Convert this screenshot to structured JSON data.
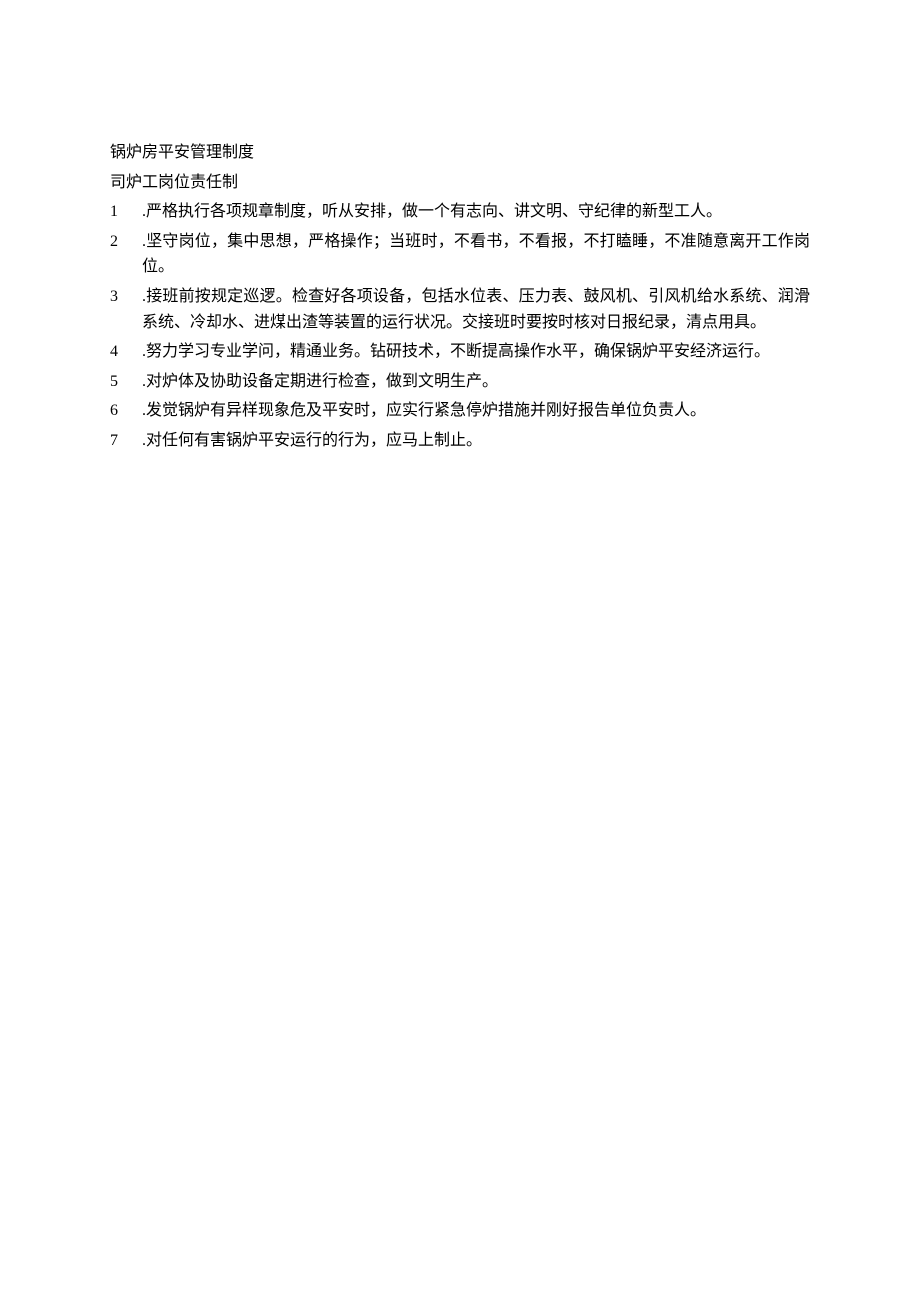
{
  "title": "锅炉房平安管理制度",
  "subtitle": "司炉工岗位责任制",
  "items": [
    {
      "number": "1",
      "text": ".严格执行各项规章制度，听从安排，做一个有志向、讲文明、守纪律的新型工人。"
    },
    {
      "number": "2",
      "text": ".坚守岗位，集中思想，严格操作；当班时，不看书，不看报，不打瞌睡，不准随意离开工作岗位。"
    },
    {
      "number": "3",
      "text": ".接班前按规定巡逻。检查好各项设备，包括水位表、压力表、鼓风机、引风机给水系统、润滑系统、冷却水、进煤出渣等装置的运行状况。交接班时要按时核对日报纪录，清点用具。"
    },
    {
      "number": "4",
      "text": ".努力学习专业学问，精通业务。钻研技术，不断提高操作水平，确保锅炉平安经济运行。"
    },
    {
      "number": "5",
      "text": ".对炉体及协助设备定期进行检查，做到文明生产。"
    },
    {
      "number": "6",
      "text": ".发觉锅炉有异样现象危及平安时，应实行紧急停炉措施并刚好报告单位负责人。"
    },
    {
      "number": "7",
      "text": ".对任何有害锅炉平安运行的行为，应马上制止。"
    }
  ]
}
